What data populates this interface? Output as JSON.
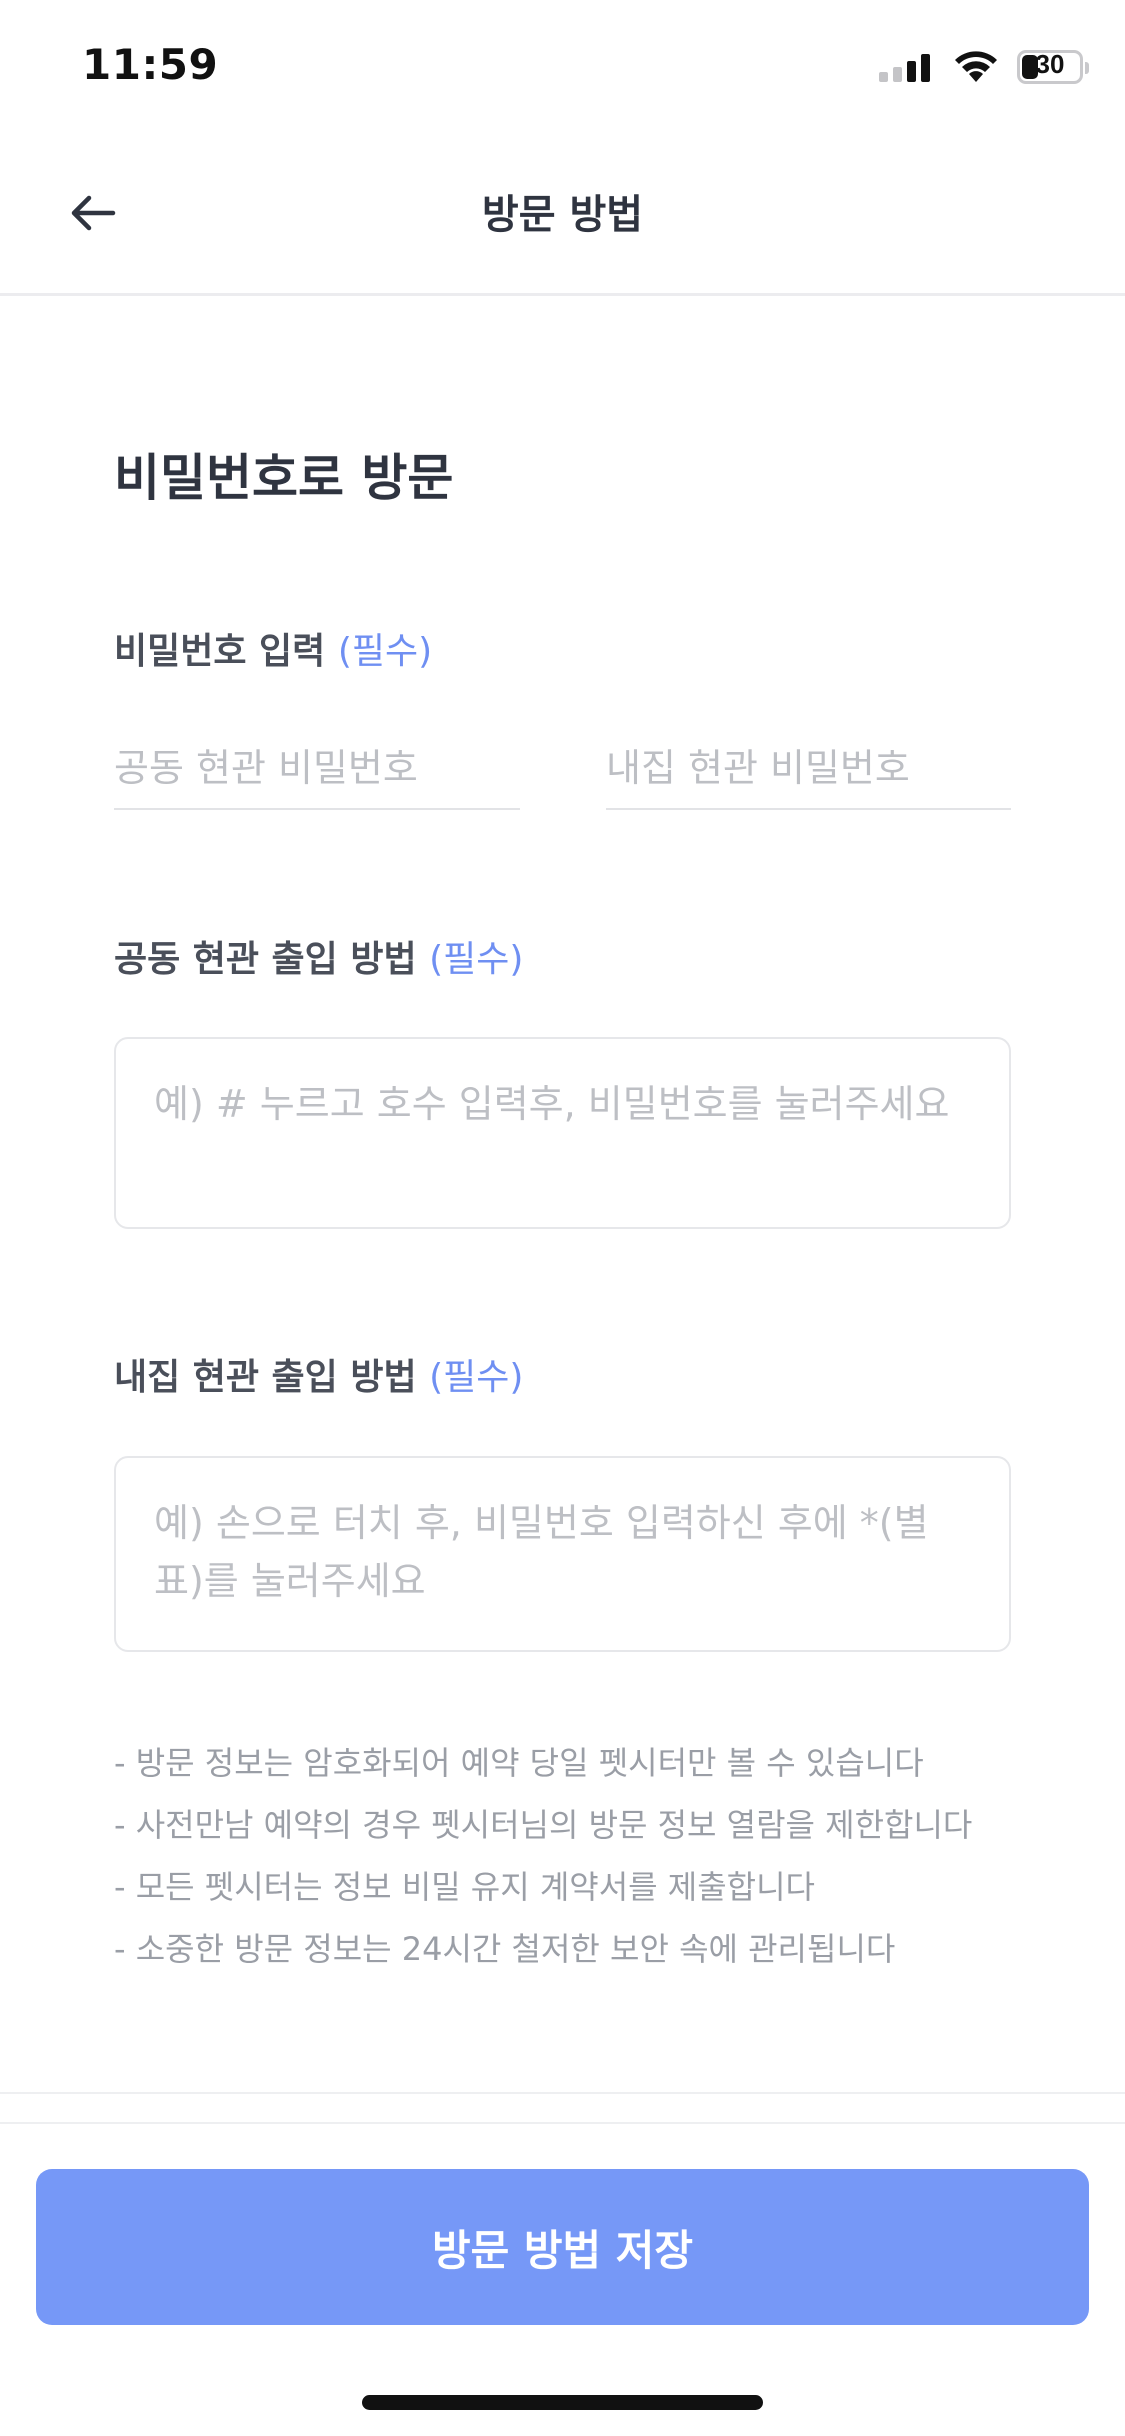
{
  "status_bar": {
    "time": "11:59",
    "battery_level": "30"
  },
  "header": {
    "title": "방문 방법",
    "back_icon": "arrow-left-icon"
  },
  "section": {
    "title": "비밀번호로 방문"
  },
  "password": {
    "label": "비밀번호 입력",
    "required": "(필수)",
    "common_placeholder": "공동 현관 비밀번호",
    "home_placeholder": "내집 현관 비밀번호",
    "common_value": "",
    "home_value": ""
  },
  "common_entry": {
    "label": "공동 현관 출입 방법",
    "required": "(필수)",
    "placeholder": "예) # 누르고 호수 입력후, 비밀번호를 눌러주세요",
    "value": ""
  },
  "home_entry": {
    "label": "내집 현관 출입 방법",
    "required": "(필수)",
    "placeholder": "예) 손으로 터치 후, 비밀번호 입력하신 후에 *(별표)를 눌러주세요",
    "value": ""
  },
  "notices": [
    "- 방문 정보는 암호화되어 예약 당일 펫시터만 볼 수 있습니다",
    "- 사전만남 예약의 경우 펫시터님의 방문 정보 열람을 제한합니다",
    "- 모든 펫시터는 정보 비밀 유지 계약서를 제출합니다",
    "- 소중한 방문 정보는 24시간 철저한 보안 속에 관리됩니다"
  ],
  "save_button": {
    "label": "방문 방법 저장"
  },
  "colors": {
    "accent": "#7698f7",
    "required_text": "#6f8ff2",
    "title_text": "#2f3440",
    "placeholder": "#bdbfc4",
    "notice_text": "#9a9ea6"
  }
}
